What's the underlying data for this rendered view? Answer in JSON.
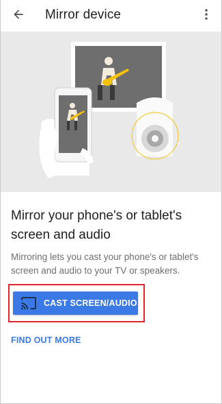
{
  "appbar": {
    "title": "Mirror device",
    "back_icon": "arrow-back-icon",
    "overflow_icon": "more-vert-icon"
  },
  "hero": {
    "illustration": "phone-mirroring-to-tv-and-speaker"
  },
  "content": {
    "headline": "Mirror your phone's or tablet's screen and audio",
    "body": "Mirroring lets you cast your phone's or tablet's screen and audio to your TV or speakers."
  },
  "actions": {
    "cast_label": "CAST SCREEN/AUDIO",
    "cast_icon": "cast-icon",
    "find_more_label": "FIND OUT MORE"
  },
  "colors": {
    "accent": "#3b79e6",
    "highlight": "#e0242c",
    "hero_bg": "#e9e9e9"
  }
}
